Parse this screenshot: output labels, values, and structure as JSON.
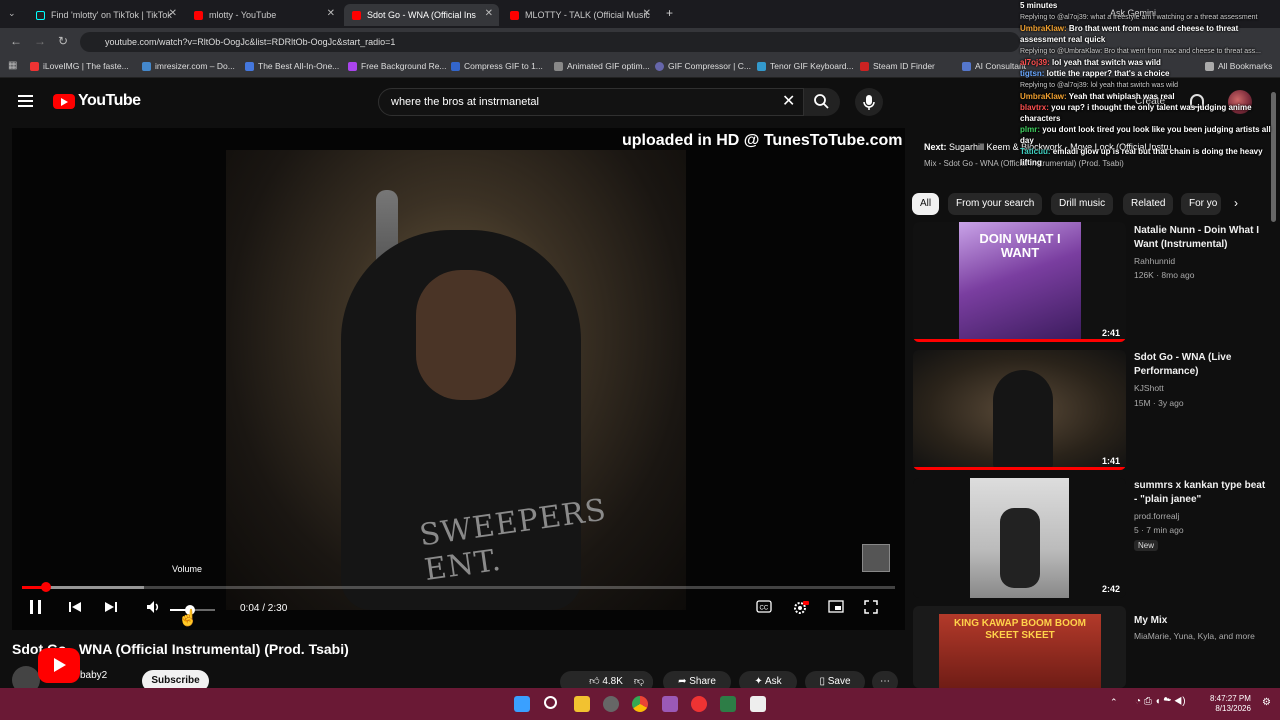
{
  "browser": {
    "tabs": [
      {
        "label": "Find 'mlotty' on TikTok | TikTok"
      },
      {
        "label": "mlotty - YouTube"
      },
      {
        "label": "Sdot Go - WNA (Official Ins"
      },
      {
        "label": "MLOTTY - TALK (Official Music"
      }
    ],
    "url": "youtube.com/watch?v=RltOb-OogJc&list=RDRltOb-OogJc&start_radio=1",
    "ask_gemini": "Ask Gemini",
    "bookmarks": [
      "iLoveIMG | The faste...",
      "imresizer.com – Do...",
      "The Best All-In-One...",
      "Free Background Re...",
      "Compress GIF to 1...",
      "Animated GIF optim...",
      "GIF Compressor | C...",
      "Tenor GIF Keyboard...",
      "Steam ID Finder",
      "AI Consultant",
      "All Bookmarks"
    ]
  },
  "youtube": {
    "logo_text": "YouTube",
    "search_query": "where the bros at instrmanetal",
    "create_label": "Create"
  },
  "player": {
    "watermark": "uploaded in HD @ TunesToTube.com",
    "next_label": "Next:",
    "next_title": "Sugarhill Keem & Blockwork - Move Lock (Official Instru",
    "mix_line": "Mix - Sdot Go - WNA (Official Instrumental) (Prod. Tsabi)",
    "volume_tooltip": "Volume",
    "time": "0:04 / 2:30",
    "hoodie_text": "SWEEPERS ENT.",
    "progress_fraction": 0.027,
    "buffer_fraction": 0.14,
    "volume_fraction": 0.45
  },
  "video": {
    "title": "Sdot Go - WNA (Official Instrumental) (Prod. Tsabi)",
    "channel": "baby2",
    "subscribe": "Subscribe",
    "likes": "4.8K",
    "share": "Share",
    "ask": "Ask",
    "save": "Save"
  },
  "chips": [
    "All",
    "From your search",
    "Drill music",
    "Related",
    "For yo"
  ],
  "recs": [
    {
      "title": "Natalie Nunn - Doin What I Want (Instrumental)",
      "channel": "Rahhunnid",
      "meta": "126K · 8mo ago",
      "duration": "2:41",
      "thumb_text": "DOIN WHAT I WANT",
      "watched_fraction": 1.0
    },
    {
      "title": "Sdot Go - WNA (Live Performance)",
      "channel": "KJShott",
      "meta": "15M · 3y ago",
      "duration": "1:41",
      "thumb_text": "",
      "watched_fraction": 1.0
    },
    {
      "title": "summrs x kankan type beat - \"plain janee\"",
      "channel": "prod.forrealj",
      "meta": "5 · 7 min ago",
      "duration": "2:42",
      "badge": "New",
      "thumb_text": "",
      "watched_fraction": 0
    },
    {
      "title": "My Mix",
      "channel": "MiaMarie, Yuna, Kyla, and more",
      "meta": "",
      "duration": "",
      "thumb_text": "KING KAWAP BOOM BOOM SKEET SKEET",
      "watched_fraction": 0
    }
  ],
  "chat": {
    "header": "5 minutes",
    "lines": [
      {
        "reply": "Replying to @al7oj39: what a freestyle am i watching or a threat assessment",
        "user": "",
        "text": "",
        "color": ""
      },
      {
        "reply": "",
        "user": "UmbraKlaw:",
        "text": "Bro that went from mac and cheese to threat assessment real quick",
        "color": "#f0a030"
      },
      {
        "reply": "Replying to @UmbraKlaw: Bro that went from mac and cheese to threat ass...",
        "user": "",
        "text": "",
        "color": ""
      },
      {
        "reply": "",
        "user": "al7oj39:",
        "text": "lol yeah that switch was wild",
        "color": "#ff5050"
      },
      {
        "reply": "",
        "user": "tigtsn:",
        "text": "lottie the rapper? that's a choice",
        "color": "#6aa8ff"
      },
      {
        "reply": "Replying to @al7oj39: lol yeah that switch was wild",
        "user": "",
        "text": "",
        "color": ""
      },
      {
        "reply": "",
        "user": "UmbraKlaw:",
        "text": "Yeah that whiplash was real",
        "color": "#f0a030"
      },
      {
        "reply": "",
        "user": "blavtrx:",
        "text": "you rap? i thought the only talent was judging anime characters",
        "color": "#ff5050"
      },
      {
        "reply": "",
        "user": "plmr:",
        "text": "you dont look tired you look like you been judging artists all day",
        "color": "#40d060"
      },
      {
        "reply": "",
        "user": "Taticuu:",
        "text": "emladi glow up is real but that chain is doing the heavy lifting",
        "color": "#40d0c0"
      }
    ]
  },
  "taskbar": {
    "time": "8:47:27 PM",
    "date": "8/13/2026"
  },
  "colors": {
    "accent": "#ff0000",
    "taskbar": "#6a1935",
    "background": "#0f0f0f"
  }
}
